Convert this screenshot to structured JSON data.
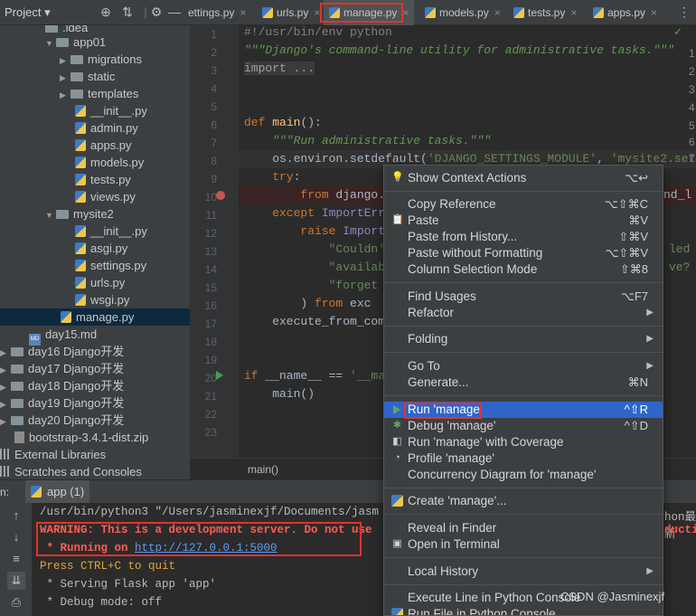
{
  "topbar": {
    "project_label": "Project ▾",
    "tabs": [
      {
        "label": "ettings.py"
      },
      {
        "label": "urls.py"
      },
      {
        "label": "manage.py"
      },
      {
        "label": "models.py"
      },
      {
        "label": "tests.py"
      },
      {
        "label": "apps.py"
      }
    ]
  },
  "sidebar": {
    "items": [
      {
        "label": ".idea"
      },
      {
        "label": "app01"
      },
      {
        "label": "migrations"
      },
      {
        "label": "static"
      },
      {
        "label": "templates"
      },
      {
        "label": "__init__.py"
      },
      {
        "label": "admin.py"
      },
      {
        "label": "apps.py"
      },
      {
        "label": "models.py"
      },
      {
        "label": "tests.py"
      },
      {
        "label": "views.py"
      },
      {
        "label": "mysite2"
      },
      {
        "label": "__init__.py"
      },
      {
        "label": "asgi.py"
      },
      {
        "label": "settings.py"
      },
      {
        "label": "urls.py"
      },
      {
        "label": "wsgi.py"
      },
      {
        "label": "manage.py"
      },
      {
        "label": "day15.md"
      },
      {
        "label": "day16 Django开发"
      },
      {
        "label": "day17 Django开发"
      },
      {
        "label": "day18 Django开发"
      },
      {
        "label": "day19 Django开发"
      },
      {
        "label": "day20 Django开发"
      },
      {
        "label": "bootstrap-3.4.1-dist.zip"
      },
      {
        "label": "External Libraries"
      },
      {
        "label": "Scratches and Consoles"
      }
    ]
  },
  "editor": {
    "line_numbers": [
      "1",
      "2",
      "3",
      "4",
      "5",
      "6",
      "7",
      "8",
      "9",
      "10",
      "11",
      "12",
      "13",
      "14",
      "15",
      "16",
      "17",
      "18",
      "19",
      "20",
      "21",
      "22",
      "23"
    ],
    "right_numbers": [
      "1",
      "2",
      "3",
      "4",
      "5",
      "6",
      "7"
    ],
    "lines": {
      "l1": "#!/usr/bin/env python",
      "l2": "\"\"\"Django's command-line utility for administrative tasks.\"\"\"",
      "l3": "import ...",
      "l6_kw": "def ",
      "l6_fn": "main",
      "l6_rest": "():",
      "l7": "    \"\"\"Run administrative tasks.\"\"\"",
      "l8_a": "    os.environ.setdefault(",
      "l8_s1": "'DJANGO_SETTINGS_MODULE'",
      "l8_b": ", ",
      "l8_s2": "'mysite2.sett",
      "l9_kw": "    try",
      "l9_rest": ":",
      "l10_kw": "        from ",
      "l10_rest": "django.c",
      "l10_tail": "nd_l",
      "l11_kw": "    except ",
      "l11_rest": "ImportErro",
      "l12_kw": "        raise ",
      "l12_rest": "Import",
      "l13": "            \"Couldn'",
      "l13_tail": "led",
      "l14": "            \"availab",
      "l14_tail": "ve?",
      "l15": "            \"forget ",
      "l16_a": "        ) ",
      "l16_kw": "from ",
      "l16_b": "exc",
      "l17": "    execute_from_comm",
      "l19_kw": "if ",
      "l19_a": "__name__ == ",
      "l19_s": "'__mai",
      "l20": "    main()"
    }
  },
  "breadcrumb": {
    "text": "main()"
  },
  "run_panel": {
    "label": "n:",
    "tab_label": "app (1)",
    "console": {
      "cmd": "/usr/bin/python3 \"/Users/jasminexjf/Documents/jasm",
      "cmd_tail": "hon最新",
      "warning": "WARNING: This is a development server. Do not use",
      "warning_tail": "ductio",
      "running_prefix": " * Running on ",
      "running_url": "http://127.0.0.1:5000",
      "press": "Press CTRL+C to quit",
      "serving": " * Serving Flask app 'app'",
      "debug": " * Debug mode: off"
    }
  },
  "context_menu": {
    "show_context_actions": {
      "label": "Show Context Actions",
      "shortcut": "⌥↩"
    },
    "copy_reference": {
      "label": "Copy Reference",
      "shortcut": "⌥⇧⌘C"
    },
    "paste": {
      "label": "Paste",
      "shortcut": "⌘V"
    },
    "paste_history": {
      "label": "Paste from History...",
      "shortcut": "⇧⌘V"
    },
    "paste_noformat": {
      "label": "Paste without Formatting",
      "shortcut": "⌥⇧⌘V"
    },
    "column_selection": {
      "label": "Column Selection Mode",
      "shortcut": "⇧⌘8"
    },
    "find_usages": {
      "label": "Find Usages",
      "shortcut": "⌥F7"
    },
    "refactor": {
      "label": "Refactor"
    },
    "folding": {
      "label": "Folding"
    },
    "go_to": {
      "label": "Go To"
    },
    "generate": {
      "label": "Generate...",
      "shortcut": "⌘N"
    },
    "run": {
      "label": "Run 'manage'",
      "shortcut": "^⇧R"
    },
    "debug": {
      "label": "Debug 'manage'",
      "shortcut": "^⇧D"
    },
    "coverage": {
      "label": "Run 'manage' with Coverage"
    },
    "profile": {
      "label": "Profile 'manage'"
    },
    "concurrency": {
      "label": "Concurrency Diagram for 'manage'"
    },
    "create": {
      "label": "Create 'manage'..."
    },
    "reveal": {
      "label": "Reveal in Finder"
    },
    "open_terminal": {
      "label": "Open in Terminal"
    },
    "local_history": {
      "label": "Local History"
    },
    "exec_line": {
      "label": "Execute Line in Python Console"
    },
    "run_file_console": {
      "label": "Run File in Python Console"
    }
  },
  "watermark": "CSDN @Jasminexjf",
  "colors": {
    "accent": "#2f65ca",
    "highlight_box": "#e0342b",
    "warning": "#ff5c56",
    "link": "#589df6"
  }
}
